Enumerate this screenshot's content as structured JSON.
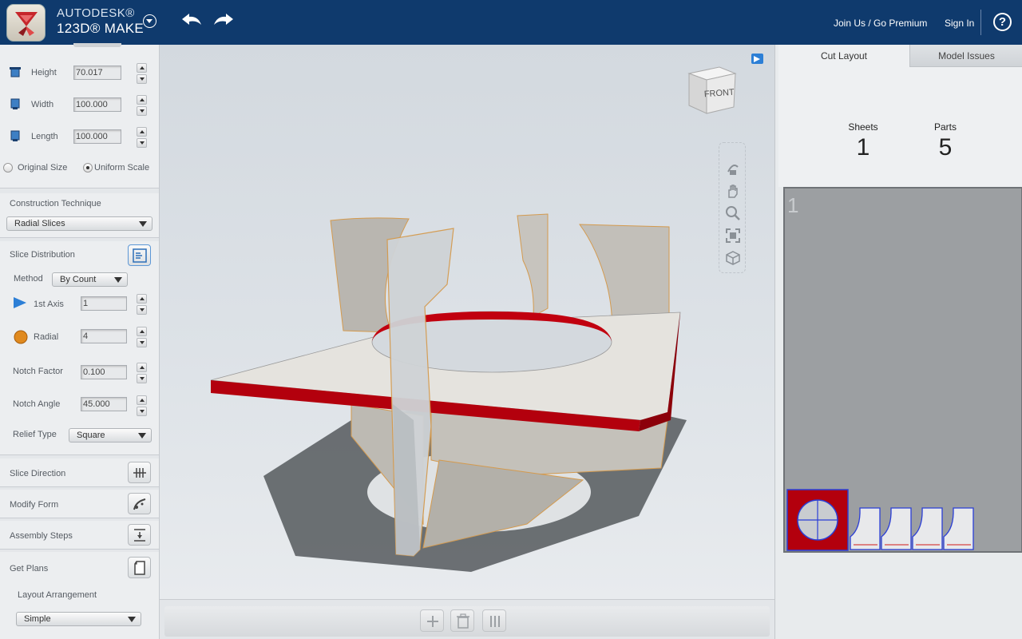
{
  "app": {
    "brand_line1": "AUTODESK®",
    "brand_line2": "123D® MAKE",
    "join_link": "Join Us / Go Premium",
    "signin_link": "Sign In",
    "help_label": "?"
  },
  "left_panel": {
    "height": {
      "label": "Height",
      "value": "70.017"
    },
    "width": {
      "label": "Width",
      "value": "100.000"
    },
    "length": {
      "label": "Length",
      "value": "100.000"
    },
    "original_size_label": "Original Size",
    "uniform_scale_label": "Uniform Scale",
    "scale_mode_selected": "Uniform Scale",
    "construction_technique": {
      "title": "Construction Technique",
      "selected": "Radial Slices"
    },
    "slice_distribution": {
      "title": "Slice Distribution",
      "method_label": "Method",
      "method_selected": "By Count",
      "axis1_label": "1st Axis",
      "axis1_value": "1",
      "radial_label": "Radial",
      "radial_value": "4",
      "notch_factor_label": "Notch Factor",
      "notch_factor_value": "0.100",
      "notch_angle_label": "Notch Angle",
      "notch_angle_value": "45.000",
      "relief_type_label": "Relief Type",
      "relief_type_selected": "Square"
    },
    "slice_direction": "Slice Direction",
    "modify_form": "Modify Form",
    "assembly_steps": "Assembly Steps",
    "get_plans": "Get Plans",
    "layout_arrangement_label": "Layout Arrangement",
    "layout_arrangement_selected": "Simple"
  },
  "viewport": {
    "viewcube_label": "FRONT"
  },
  "right_panel": {
    "tabs": [
      {
        "label": "Cut Layout",
        "active": true
      },
      {
        "label": "Model Issues",
        "active": false
      }
    ],
    "sheets_label": "Sheets",
    "sheets_value": "1",
    "parts_label": "Parts",
    "parts_value": "5",
    "sheet_number": "1"
  },
  "colors": {
    "topbar": "#0f3a6d",
    "accent_red": "#b3000d",
    "part_outline": "#2a3ed6"
  }
}
